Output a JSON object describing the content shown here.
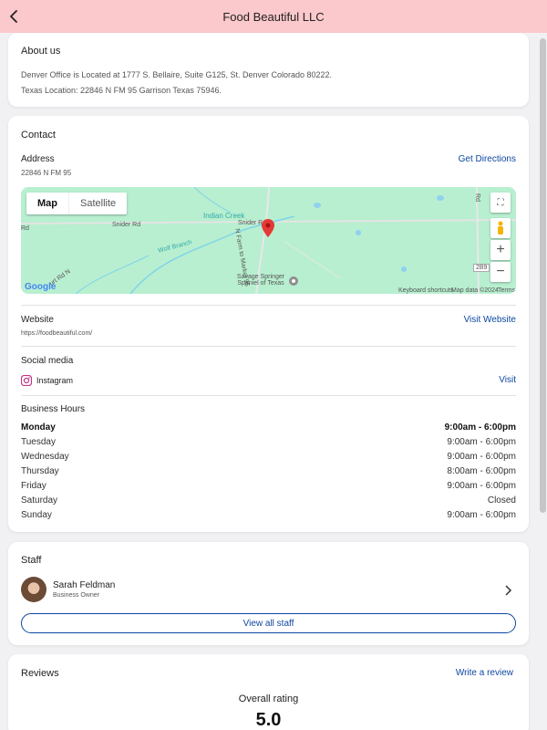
{
  "header": {
    "title": "Food Beautiful LLC"
  },
  "about": {
    "title": "About us",
    "line1": "Denver Office is Located at 1777 S. Bellaire, Suite G125, St. Denver Colorado 80222.",
    "line2": "Texas Location: 22846 N FM 95 Garrison Texas 75946."
  },
  "contact": {
    "title": "Contact",
    "address_label": "Address",
    "address_value": "22846 N FM 95",
    "directions": "Get Directions",
    "map": {
      "tab_map": "Map",
      "tab_satellite": "Satellite",
      "labels": {
        "indian_creek": "Indian Creek",
        "snider_rd_1": "Snider Rd",
        "snider_rd_2": "Snider Rd",
        "wolf_branch": "Wolf Branch",
        "fm95": "N Farm to Market 95",
        "poi": "Savage Springer Spaniel of Texas",
        "rd_left": "Rd",
        "rd_right": "Rd",
        "shield": "2B9",
        "bottom_rd": "urt Rd N"
      },
      "zoom_in": "+",
      "zoom_out": "−",
      "logo": "Google",
      "shortcuts": "Keyboard shortcuts",
      "mapdata": "Map data ©2024",
      "terms": "Terms"
    },
    "website_label": "Website",
    "website_value": "https://foodbeautiful.com/",
    "website_link": "Visit Website",
    "social_label": "Social media",
    "instagram": "Instagram",
    "visit": "Visit"
  },
  "hours": {
    "title": "Business Hours",
    "rows": [
      {
        "day": "Monday",
        "time": "9:00am - 6:00pm"
      },
      {
        "day": "Tuesday",
        "time": "9:00am - 6:00pm"
      },
      {
        "day": "Wednesday",
        "time": "9:00am - 6:00pm"
      },
      {
        "day": "Thursday",
        "time": "8:00am - 6:00pm"
      },
      {
        "day": "Friday",
        "time": "9:00am - 6:00pm"
      },
      {
        "day": "Saturday",
        "time": "Closed"
      },
      {
        "day": "Sunday",
        "time": "9:00am - 6:00pm"
      }
    ]
  },
  "staff": {
    "title": "Staff",
    "member_name": "Sarah Feldman",
    "member_role": "Business Owner",
    "view_all": "View all staff"
  },
  "reviews": {
    "title": "Reviews",
    "write": "Write a review",
    "overall_label": "Overall rating",
    "overall_value": "5.0"
  },
  "colors": {
    "header_bg": "#fbc8cb",
    "link": "#0d47a1",
    "map_bg": "#b8efd0",
    "pin": "#e53935"
  }
}
